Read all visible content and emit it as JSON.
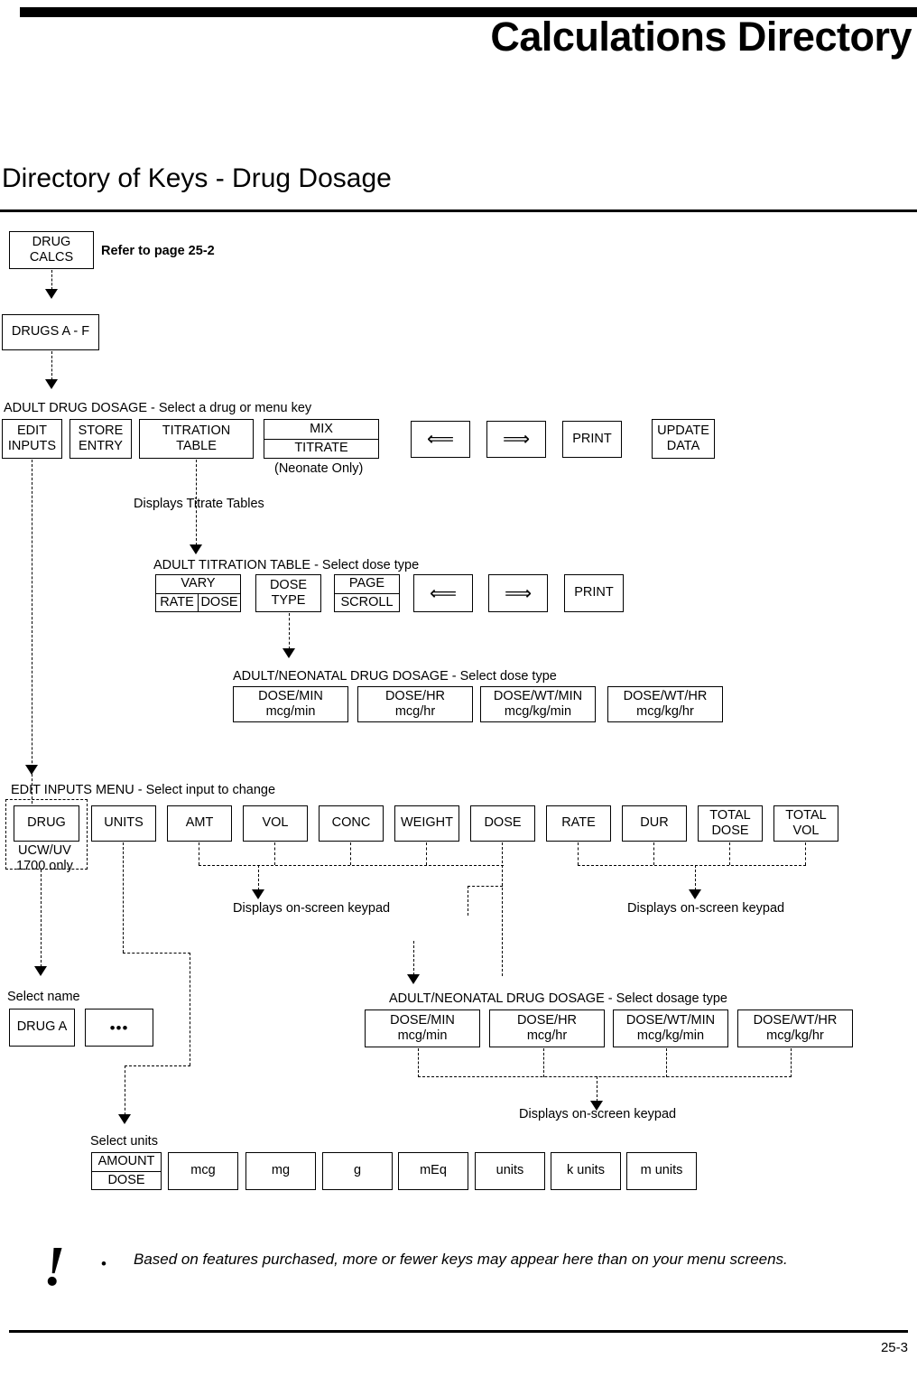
{
  "header": {
    "chapter_title": "Calculations Directory",
    "section_title": "Directory of Keys - Drug Dosage",
    "page_number": "25-3"
  },
  "flow": {
    "drug_calcs": {
      "line1": "DRUG",
      "line2": "CALCS"
    },
    "refer_note": "Refer to page 25-2",
    "drugs_af": "DRUGS A - F",
    "adult_drug_dosage_header": "ADULT DRUG DOSAGE - Select a drug or menu key",
    "adult_drug_dosage_keys": {
      "edit_inputs": {
        "line1": "EDIT",
        "line2": "INPUTS"
      },
      "store_entry": {
        "line1": "STORE",
        "line2": "ENTRY"
      },
      "titration_table": {
        "line1": "TITRATION",
        "line2": "TABLE"
      },
      "mix_titrate": {
        "line1": "MIX",
        "line2": "TITRATE",
        "caption": "(Neonate Only)"
      },
      "prev_arrow": "⟸",
      "next_arrow": "⟹",
      "print": "PRINT",
      "update_data": {
        "line1": "UPDATE",
        "line2": "DATA"
      }
    },
    "displays_titrate_tables": "Displays Titrate Tables",
    "adult_titration_header": "ADULT TITRATION TABLE - Select dose type",
    "adult_titration_keys": {
      "vary": {
        "title": "VARY",
        "left": "RATE",
        "right": "DOSE"
      },
      "dose_type": {
        "line1": "DOSE",
        "line2": "TYPE"
      },
      "page_scroll": {
        "line1": "PAGE",
        "line2": "SCROLL"
      },
      "prev_arrow": "⟸",
      "next_arrow": "⟹",
      "print": "PRINT"
    },
    "dose_type_header": "ADULT/NEONATAL DRUG DOSAGE - Select dose type",
    "dose_type_keys": [
      {
        "line1": "DOSE/MIN",
        "line2": "mcg/min"
      },
      {
        "line1": "DOSE/HR",
        "line2": "mcg/hr"
      },
      {
        "line1": "DOSE/WT/MIN",
        "line2": "mcg/kg/min"
      },
      {
        "line1": "DOSE/WT/HR",
        "line2": "mcg/kg/hr"
      }
    ],
    "edit_inputs_header": "EDIT INPUTS MENU - Select input to change",
    "edit_inputs_keys": [
      {
        "line1": "DRUG",
        "line2": ""
      },
      {
        "line1": "UNITS",
        "line2": ""
      },
      {
        "line1": "AMT",
        "line2": ""
      },
      {
        "line1": "VOL",
        "line2": ""
      },
      {
        "line1": "CONC",
        "line2": ""
      },
      {
        "line1": "WEIGHT",
        "line2": ""
      },
      {
        "line1": "DOSE",
        "line2": ""
      },
      {
        "line1": "RATE",
        "line2": ""
      },
      {
        "line1": "DUR",
        "line2": ""
      },
      {
        "line1": "TOTAL",
        "line2": "DOSE"
      },
      {
        "line1": "TOTAL",
        "line2": "VOL"
      }
    ],
    "ucw_uv_note": {
      "line1": "UCW/UV",
      "line2": "1700 only"
    },
    "displays_keypad_left": "Displays on-screen keypad",
    "displays_keypad_right": "Displays on-screen keypad",
    "select_name_label": "Select name",
    "select_name_keys": [
      {
        "label": "DRUG A"
      },
      {
        "label": "•••"
      }
    ],
    "dosage_type_header": "ADULT/NEONATAL DRUG DOSAGE - Select dosage type",
    "dosage_type_keys": [
      {
        "line1": "DOSE/MIN",
        "line2": "mcg/min"
      },
      {
        "line1": "DOSE/HR",
        "line2": "mcg/hr"
      },
      {
        "line1": "DOSE/WT/MIN",
        "line2": "mcg/kg/min"
      },
      {
        "line1": "DOSE/WT/HR",
        "line2": "mcg/kg/hr"
      }
    ],
    "displays_keypad_bottom": "Displays on-screen keypad",
    "select_units_label": "Select units",
    "amount_dose": {
      "line1": "AMOUNT",
      "line2": "DOSE"
    },
    "unit_keys": [
      {
        "label": "mcg"
      },
      {
        "label": "mg"
      },
      {
        "label": "g"
      },
      {
        "label": "mEq"
      },
      {
        "label": "units"
      },
      {
        "label": "k units"
      },
      {
        "label": "m units"
      }
    ]
  },
  "footer": {
    "warning_glyph": "!",
    "bullet": "•",
    "note": "Based on features purchased, more or fewer keys may appear here than on your menu screens."
  }
}
